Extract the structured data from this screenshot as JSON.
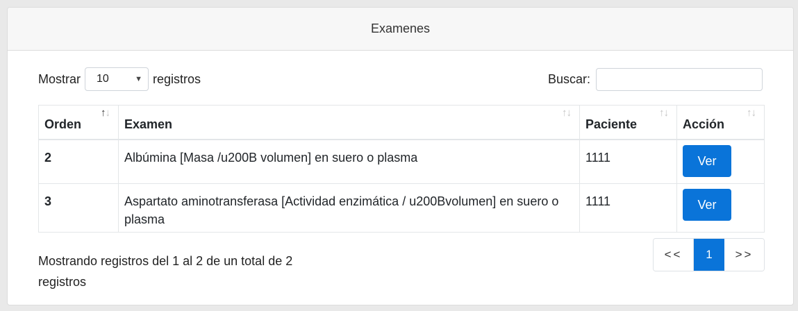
{
  "header": {
    "title": "Examenes"
  },
  "length": {
    "prefix": "Mostrar",
    "value": "10",
    "suffix": "registros"
  },
  "search": {
    "label": "Buscar:",
    "value": ""
  },
  "table": {
    "columns": [
      "Orden",
      "Examen",
      "Paciente",
      "Acción"
    ],
    "sort_icon": "↑↓",
    "rows": [
      {
        "orden": "2",
        "examen": "Albúmina [Masa /u200B volumen] en suero o plasma",
        "paciente": "1111",
        "accion": "Ver"
      },
      {
        "orden": "3",
        "examen": "Aspartato aminotransferasa [Actividad enzimática / u200Bvolumen] en suero o plasma",
        "paciente": "1111",
        "accion": "Ver"
      }
    ]
  },
  "footer": {
    "info": "Mostrando registros del 1 al 2 de un total de 2 registros",
    "pager": {
      "prev": "<<",
      "current": "1",
      "next": ">>"
    }
  },
  "colors": {
    "primary": "#0a74d9",
    "header_bg": "#f7f7f7",
    "border": "#dcdcdc"
  }
}
